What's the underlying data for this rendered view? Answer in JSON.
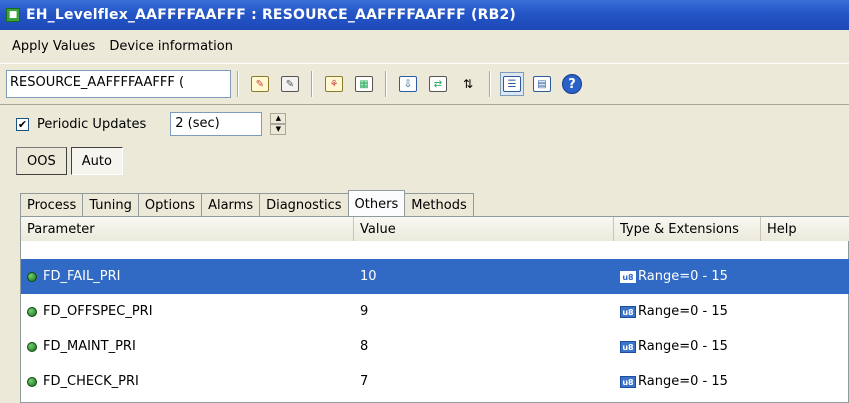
{
  "window": {
    "title": "EH_Levelflex_AAFFFFAAFFF : RESOURCE_AAFFFFAAFFF (RB2)",
    "icon": "app-icon"
  },
  "menu": {
    "items": [
      "Apply Values",
      "Device information"
    ]
  },
  "toolbar": {
    "combo_value": "RESOURCE_AAFFFFAAFFF (",
    "icons": [
      "edit-doc-icon",
      "edit-doc-alt-icon",
      "tree-icon",
      "compare-icon",
      "download-icon",
      "transfer-icon",
      "sort-icon",
      "detail-view-icon",
      "list-view-icon",
      "help-icon"
    ]
  },
  "periodic": {
    "label": "Periodic Updates",
    "checked": true,
    "interval_value": "2 (sec)"
  },
  "modes": {
    "oos": "OOS",
    "auto": "Auto"
  },
  "tabs": [
    "Process",
    "Tuning",
    "Options",
    "Alarms",
    "Diagnostics",
    "Others",
    "Methods"
  ],
  "active_tab": "Others",
  "grid": {
    "columns": [
      "Parameter",
      "Value",
      "Type & Extensions",
      "Help"
    ],
    "rows": [
      {
        "parameter": "FD_FAIL_PRI",
        "value": "10",
        "type_badge": "u8",
        "range": "Range=0 - 15",
        "selected": true
      },
      {
        "parameter": "FD_OFFSPEC_PRI",
        "value": "9",
        "type_badge": "u8",
        "range": "Range=0 - 15",
        "selected": false
      },
      {
        "parameter": "FD_MAINT_PRI",
        "value": "8",
        "type_badge": "u8",
        "range": "Range=0 - 15",
        "selected": false
      },
      {
        "parameter": "FD_CHECK_PRI",
        "value": "7",
        "type_badge": "u8",
        "range": "Range=0 - 15",
        "selected": false
      }
    ]
  },
  "colors": {
    "titlebar": "#2455c6",
    "selection": "#316ac5",
    "window_bg": "#ece9d8"
  }
}
